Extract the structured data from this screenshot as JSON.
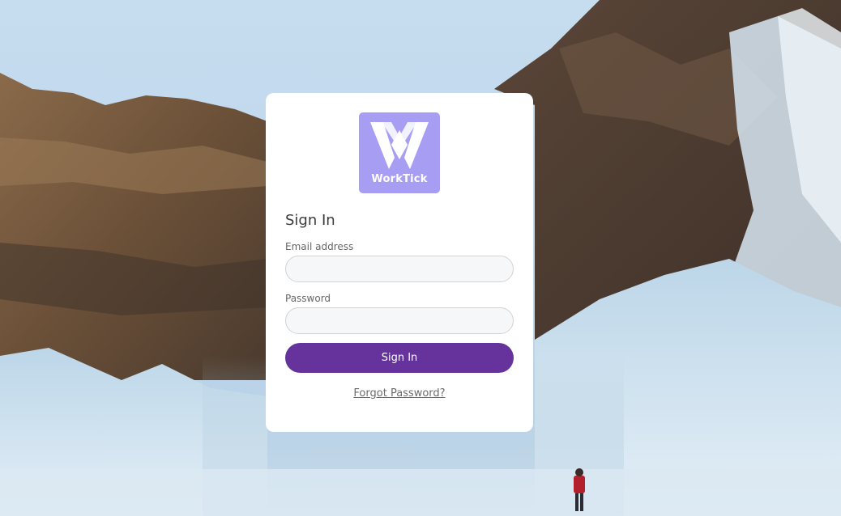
{
  "brand": {
    "name": "WorkTick",
    "logo_color": "#a79ef3"
  },
  "login": {
    "title": "Sign In",
    "email_label": "Email address",
    "email_value": "",
    "password_label": "Password",
    "password_value": "",
    "submit_label": "Sign In",
    "forgot_link": "Forgot Password?"
  },
  "colors": {
    "primary_button": "#65339b",
    "card_background": "#ffffff",
    "input_background": "#f6f7f9"
  },
  "background": {
    "icon": "frozen-waterfall-photo"
  }
}
